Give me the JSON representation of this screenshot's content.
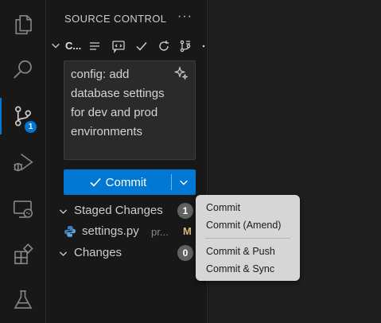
{
  "activity_bar": {
    "items": [
      {
        "name": "explorer",
        "icon": "files-icon"
      },
      {
        "name": "search",
        "icon": "search-icon"
      },
      {
        "name": "source-control",
        "icon": "source-control-icon",
        "badge": "1",
        "active": true
      },
      {
        "name": "run-debug",
        "icon": "run-debug-icon"
      },
      {
        "name": "remote-explorer",
        "icon": "remote-explorer-icon"
      },
      {
        "name": "extensions",
        "icon": "extensions-icon"
      },
      {
        "name": "testing",
        "icon": "flask-icon"
      }
    ],
    "source_control_badge": "1"
  },
  "sidebar": {
    "title": "SOURCE CONTROL",
    "more": "···",
    "repo": {
      "name": "C...",
      "toolbar_icons": [
        "list-icon",
        "comment-icon",
        "check-icon",
        "refresh-icon",
        "graph-icon",
        "more-icon"
      ]
    },
    "commit_message": "config: add database settings for dev and prod environments",
    "commit_button": "Commit",
    "sections": {
      "staged": {
        "label": "Staged Changes",
        "count": "1"
      },
      "changes": {
        "label": "Changes",
        "count": "0"
      }
    },
    "file": {
      "name": "settings.py",
      "path": "pr...",
      "status": "M"
    }
  },
  "menu": {
    "items": [
      "Commit",
      "Commit (Amend)",
      "Commit & Push",
      "Commit & Sync"
    ]
  },
  "colors": {
    "accent": "#0078d4",
    "modified": "#d7ba7d",
    "background": "#181818"
  }
}
